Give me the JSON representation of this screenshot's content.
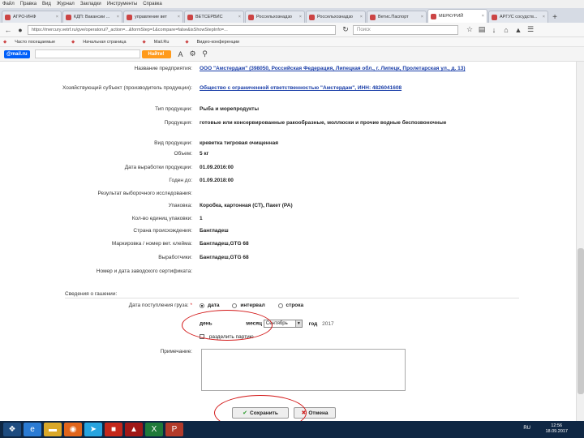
{
  "menubar": [
    "Файл",
    "Правка",
    "Вид",
    "Журнал",
    "Закладки",
    "Инструменты",
    "Справка"
  ],
  "tabs": [
    {
      "label": "АГРО-ИНФ",
      "active": false
    },
    {
      "label": "КДП: Вакансии ...",
      "active": false
    },
    {
      "label": "управление вет",
      "active": false
    },
    {
      "label": "ВЕТСЕРВИС",
      "active": false
    },
    {
      "label": "Россельхознадзо",
      "active": false
    },
    {
      "label": "Россельхознадзо",
      "active": false
    },
    {
      "label": "Ветис.Паспорт",
      "active": false
    },
    {
      "label": "МЕРКУРИЙ",
      "active": true
    },
    {
      "label": "АРГУС сосудств...",
      "active": false
    }
  ],
  "navbar": {
    "url": "https://mercury.vetrf.ru/gve/operatorui?_action=...&formStep=1&compare=false&isShowStepInfo=...",
    "search_placeholder": "Поиск"
  },
  "bookmarks": [
    "Часто посещаемые",
    "Начальная страница",
    "Mail.Ru",
    "Видео-конференции"
  ],
  "mailbar": {
    "logo": "@mail.ru",
    "find_label": "Найти!"
  },
  "fields": [
    {
      "label": "Название предприятия:",
      "value": "ООО \"Амстердам\" (398050, Российская Федерация, Липецкая обл., г. Липецк, Пролетарская ул., д. 13)",
      "link": true
    },
    {
      "label": "Хозяйствующий субъект (производитель продукции):",
      "value": "Общество с ограниченной ответственностью \"Амстердам\", ИНН: 4826041608",
      "link": true
    },
    {
      "label": "Тип продукции:",
      "value": "Рыба и морепродукты",
      "link": false
    },
    {
      "label": "Продукция:",
      "value": "готовые или консервированные ракообразные, моллюски и прочие водные беспозвоночные",
      "link": false
    },
    {
      "label": "Вид продукции:",
      "value": "креветка тигровая очищенная",
      "link": false
    },
    {
      "label": "Объем:",
      "value": "5 кг",
      "link": false
    },
    {
      "label": "Дата выработки продукции:",
      "value": "01.09.2016:00",
      "link": false
    },
    {
      "label": "Годен до:",
      "value": "01.09.2018:00",
      "link": false
    },
    {
      "label": "Результат выборочного исследования:",
      "value": "",
      "link": false
    },
    {
      "label": "Упаковка:",
      "value": "Коробка, картонная (СТ), Пакет (PA)",
      "link": false
    },
    {
      "label": "Кол-во единиц упаковки:",
      "value": "1",
      "link": false
    },
    {
      "label": "Страна происхождения:",
      "value": "Бангладеш",
      "link": false
    },
    {
      "label": "Маркировка / номер вет. клейма:",
      "value": "Бангладеш,GTG 68",
      "link": false
    },
    {
      "label": "Выработчики:",
      "value": "Бангладеш,GTG 68",
      "link": false
    },
    {
      "label": "Номер и дата заводского сертификата:",
      "value": "",
      "link": false
    }
  ],
  "arrival": {
    "section_title": "Сведения о гашении:",
    "date_label": "Дата поступления груза:",
    "required_mark": "*",
    "radio_date": "дата",
    "radio_interval": "интервал",
    "radio_string": "строка",
    "day_label": "день",
    "month_label": "месяц",
    "month_value": "Сентябрь",
    "year_label": "год",
    "year_value": "2017",
    "split_label": "разделить партию",
    "note_label": "Примечание:"
  },
  "buttons": {
    "save": "Сохранить",
    "cancel": "Отмена"
  },
  "taskbar": {
    "lang": "RU",
    "time": "12:56",
    "date": "18.09.2017"
  },
  "colors": {
    "accent_red": "#d31818",
    "link_blue": "#1a3ea8",
    "taskbar": "#0f2744",
    "mail_orange": "#ff9a1a"
  }
}
